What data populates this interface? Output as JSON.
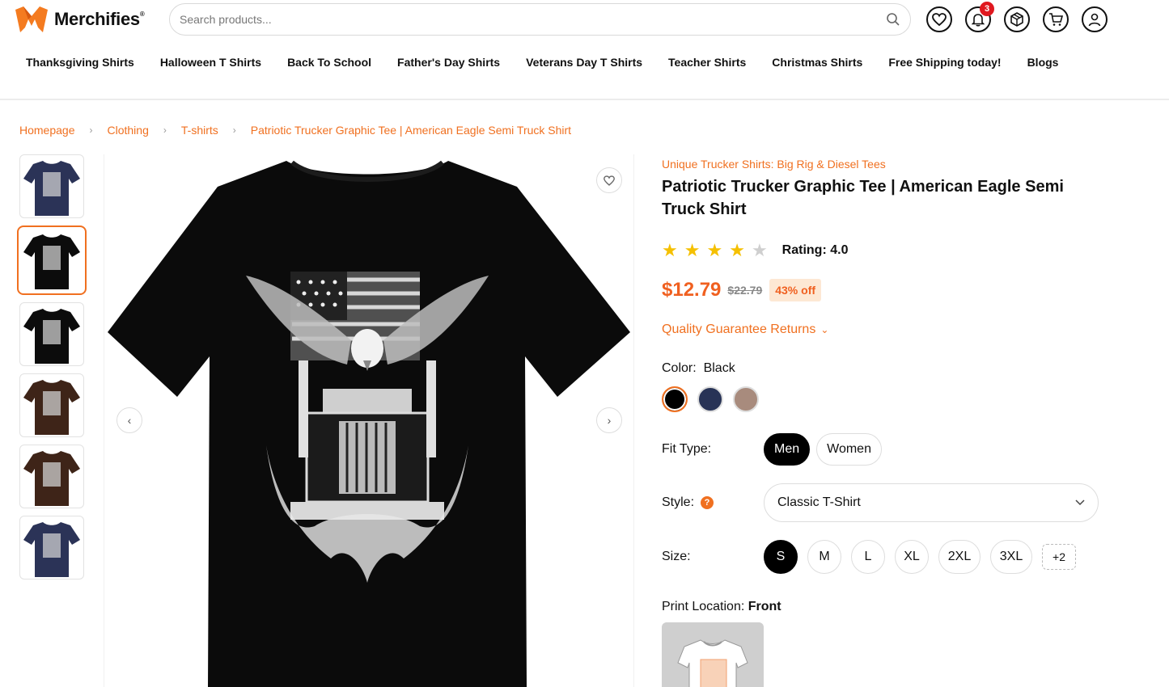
{
  "header": {
    "brand": "Merchifies",
    "search_placeholder": "Search products...",
    "notification_count": "3"
  },
  "nav": [
    "Thanksgiving Shirts",
    "Halloween T Shirts",
    "Back To School",
    "Father's Day Shirts",
    "Veterans Day T Shirts",
    "Teacher Shirts",
    "Christmas Shirts",
    "Free Shipping today!",
    "Blogs"
  ],
  "breadcrumb": [
    "Homepage",
    "Clothing",
    "T-shirts",
    "Patriotic Trucker Graphic Tee | American Eagle Semi Truck Shirt"
  ],
  "gallery": {
    "thumb_colors": [
      "#2b3357",
      "#0c0c0c",
      "#0c0c0c",
      "#3e2418",
      "#3e2418",
      "#2b3357"
    ],
    "active_index": 1
  },
  "product": {
    "collection": "Unique Trucker Shirts: Big Rig & Diesel Tees",
    "title": "Patriotic Trucker Graphic Tee | American Eagle Semi Truck Shirt",
    "rating_value": 4,
    "rating_text": "Rating: 4.0",
    "price": "$12.79",
    "old_price": "$22.79",
    "discount": "43% off",
    "guarantee": "Quality Guarantee Returns",
    "color_label": "Color:",
    "color_value": "Black",
    "colors": [
      "#000000",
      "#283356",
      "#a88b7d"
    ],
    "fit_label": "Fit Type:",
    "fit_options": [
      "Men",
      "Women"
    ],
    "style_label": "Style:",
    "style_value": "Classic T-Shirt",
    "size_label": "Size:",
    "sizes": [
      "S",
      "M",
      "L",
      "XL",
      "2XL",
      "3XL"
    ],
    "more_sizes": "+2",
    "print_label": "Print Location:",
    "print_value": "Front"
  }
}
